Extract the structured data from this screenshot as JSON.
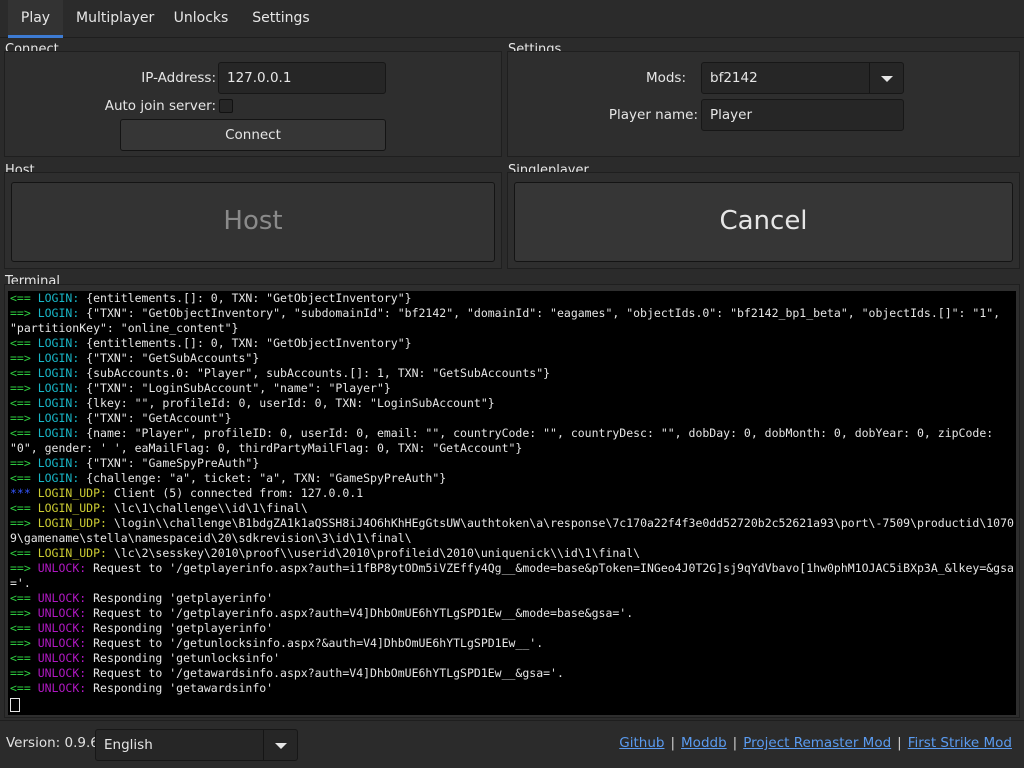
{
  "tabs": [
    {
      "label": "Play",
      "active": true
    },
    {
      "label": "Multiplayer",
      "active": false
    },
    {
      "label": "Unlocks",
      "active": false
    },
    {
      "label": "Settings",
      "active": false
    }
  ],
  "connect": {
    "title": "Connect",
    "ip_label": "IP-Address:",
    "ip_value": "127.0.0.1",
    "auto_join_label": "Auto join server:",
    "auto_join_checked": false,
    "connect_button": "Connect"
  },
  "settings": {
    "title": "Settings",
    "mods_label": "Mods:",
    "mods_value": "bf2142",
    "player_label": "Player name:",
    "player_value": "Player"
  },
  "host": {
    "title": "Host",
    "button": "Host",
    "enabled": false
  },
  "singleplayer": {
    "title": "Singleplayer",
    "button": "Cancel"
  },
  "terminal": {
    "title": "Terminal",
    "lines": [
      {
        "prefix": "<== ",
        "tag": "LOGIN:",
        "color": "cyan",
        "text": " {entitlements.[]: 0, TXN: \"GetObjectInventory\"}"
      },
      {
        "prefix": "==> ",
        "tag": "LOGIN:",
        "color": "cyan",
        "text": " {\"TXN\": \"GetObjectInventory\", \"subdomainId\": \"bf2142\", \"domainId\": \"eagames\", \"objectIds.0\": \"bf2142_bp1_beta\", \"objectIds.[]\": \"1\", \"partitionKey\": \"online_content\"}"
      },
      {
        "prefix": "<== ",
        "tag": "LOGIN:",
        "color": "cyan",
        "text": " {entitlements.[]: 0, TXN: \"GetObjectInventory\"}"
      },
      {
        "prefix": "==> ",
        "tag": "LOGIN:",
        "color": "cyan",
        "text": " {\"TXN\": \"GetSubAccounts\"}"
      },
      {
        "prefix": "<== ",
        "tag": "LOGIN:",
        "color": "cyan",
        "text": " {subAccounts.0: \"Player\", subAccounts.[]: 1, TXN: \"GetSubAccounts\"}"
      },
      {
        "prefix": "==> ",
        "tag": "LOGIN:",
        "color": "cyan",
        "text": " {\"TXN\": \"LoginSubAccount\", \"name\": \"Player\"}"
      },
      {
        "prefix": "<== ",
        "tag": "LOGIN:",
        "color": "cyan",
        "text": " {lkey: \"\", profileId: 0, userId: 0, TXN: \"LoginSubAccount\"}"
      },
      {
        "prefix": "==> ",
        "tag": "LOGIN:",
        "color": "cyan",
        "text": " {\"TXN\": \"GetAccount\"}"
      },
      {
        "prefix": "<== ",
        "tag": "LOGIN:",
        "color": "cyan",
        "text": " {name: \"Player\", profileID: 0, userId: 0, email: \"\", countryCode: \"\", countryDesc: \"\", dobDay: 0, dobMonth: 0, dobYear: 0, zipCode: \"0\", gender: ' ', eaMailFlag: 0, thirdPartyMailFlag: 0, TXN: \"GetAccount\"}"
      },
      {
        "prefix": "==> ",
        "tag": "LOGIN:",
        "color": "cyan",
        "text": " {\"TXN\": \"GameSpyPreAuth\"}"
      },
      {
        "prefix": "<== ",
        "tag": "LOGIN:",
        "color": "cyan",
        "text": " {challenge: \"a\", ticket: \"a\", TXN: \"GameSpyPreAuth\"}"
      },
      {
        "prefix": "*** ",
        "tag": "LOGIN_UDP:",
        "color": "yellow",
        "prefix_color": "blue",
        "text": " Client (5) connected from: 127.0.0.1"
      },
      {
        "prefix": "<== ",
        "tag": "LOGIN_UDP:",
        "color": "yellow",
        "text": " \\lc\\1\\challenge\\\\id\\1\\final\\"
      },
      {
        "prefix": "==> ",
        "tag": "LOGIN_UDP:",
        "color": "yellow",
        "text": " \\login\\\\challenge\\B1bdgZA1k1aQSSH8iJ4O6hKhHEgGtsUW\\authtoken\\a\\response\\7c170a22f4f3e0dd52720b2c52621a93\\port\\-7509\\productid\\10709\\gamename\\stella\\namespaceid\\20\\sdkrevision\\3\\id\\1\\final\\"
      },
      {
        "prefix": "<== ",
        "tag": "LOGIN_UDP:",
        "color": "yellow",
        "text": " \\lc\\2\\sesskey\\2010\\proof\\\\userid\\2010\\profileid\\2010\\uniquenick\\\\id\\1\\final\\"
      },
      {
        "prefix": "==> ",
        "tag": "UNLOCK:",
        "color": "magenta",
        "text": " Request to '/getplayerinfo.aspx?auth=i1fBP8ytODm5iVZEffy4Qg__&mode=base&pToken=INGeo4J0T2G]sj9qYdVbavo[1hw0phM1OJAC5iBXp3A_&lkey=&gsa='."
      },
      {
        "prefix": "<== ",
        "tag": "UNLOCK:",
        "color": "magenta",
        "text": " Responding 'getplayerinfo'"
      },
      {
        "prefix": "==> ",
        "tag": "UNLOCK:",
        "color": "magenta",
        "text": " Request to '/getplayerinfo.aspx?auth=V4]DhbOmUE6hYTLgSPD1Ew__&mode=base&gsa='."
      },
      {
        "prefix": "<== ",
        "tag": "UNLOCK:",
        "color": "magenta",
        "text": " Responding 'getplayerinfo'"
      },
      {
        "prefix": "==> ",
        "tag": "UNLOCK:",
        "color": "magenta",
        "text": " Request to '/getunlocksinfo.aspx?&auth=V4]DhbOmUE6hYTLgSPD1Ew__'."
      },
      {
        "prefix": "<== ",
        "tag": "UNLOCK:",
        "color": "magenta",
        "text": " Responding 'getunlocksinfo'"
      },
      {
        "prefix": "==> ",
        "tag": "UNLOCK:",
        "color": "magenta",
        "text": " Request to '/getawardsinfo.aspx?auth=V4]DhbOmUE6hYTLgSPD1Ew__&gsa='."
      },
      {
        "prefix": "<== ",
        "tag": "UNLOCK:",
        "color": "magenta",
        "text": " Responding 'getawardsinfo'"
      }
    ]
  },
  "footer": {
    "version_label": "Version: 0.9.6",
    "language_value": "English",
    "links": [
      "Github",
      "Moddb",
      "Project Remaster Mod",
      "First Strike Mod"
    ],
    "separator": "|"
  },
  "colors": {
    "accent": "#3d7bd3",
    "link": "#5a9bf0",
    "terminal_green": "#2ecc40",
    "terminal_cyan": "#18b6c7",
    "terminal_blue": "#3355ff",
    "terminal_yellow": "#cccc33",
    "terminal_magenta": "#b018c2"
  },
  "icons": {
    "combo_arrow": "chevron-down-icon"
  }
}
